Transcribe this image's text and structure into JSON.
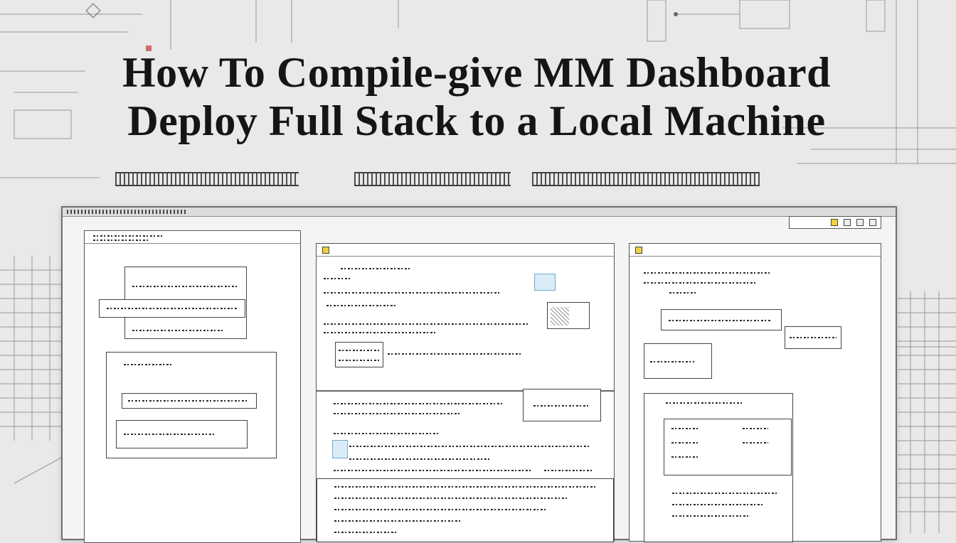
{
  "headline": {
    "line1": "How To Compile-give MM Dashboard",
    "line2": "Deploy Full Stack to a Local Machine"
  },
  "colors": {
    "background": "#e9e9e9",
    "panel": "#ffffff",
    "ink": "#1c1c1c",
    "accent_blue": "#7aa9c9",
    "accent_yellow": "#f2d23c"
  },
  "window": {
    "panels": [
      {
        "id": "left"
      },
      {
        "id": "middle"
      },
      {
        "id": "right"
      }
    ]
  }
}
